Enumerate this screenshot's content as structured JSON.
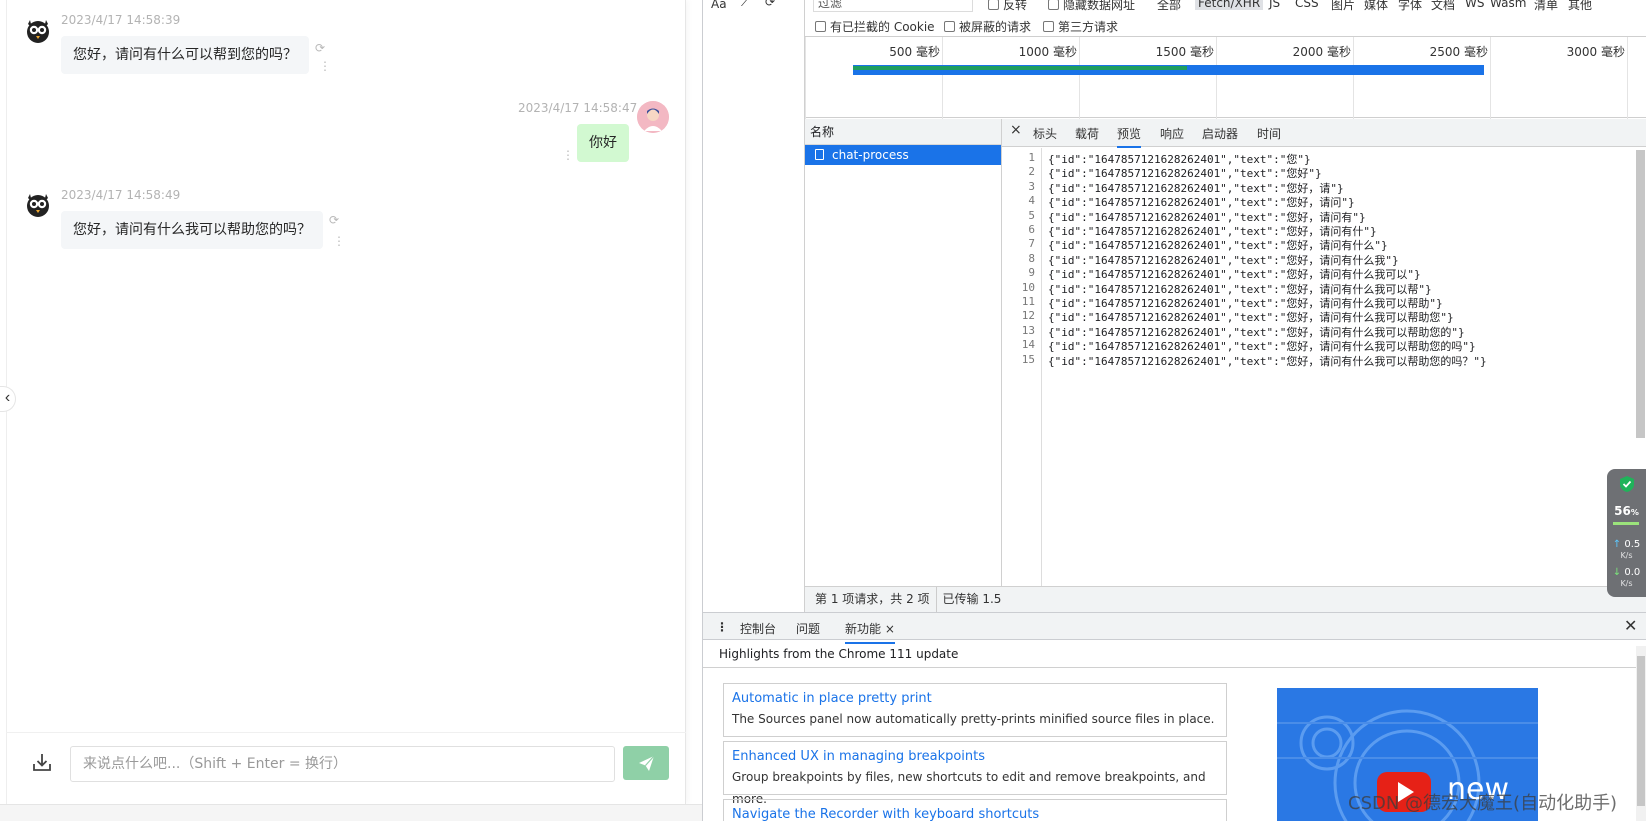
{
  "chat": {
    "messages": [
      {
        "role": "assistant",
        "time": "2023/4/17 14:58:39",
        "text": "您好，请问有什么可以帮到您的吗？"
      },
      {
        "role": "user",
        "time": "2023/4/17 14:58:47",
        "text": "你好"
      },
      {
        "role": "assistant",
        "time": "2023/4/17 14:58:49",
        "text": "您好，请问有什么我可以帮助您的吗？"
      }
    ],
    "input_placeholder": "来说点什么吧...（Shift + Enter = 换行）",
    "colors": {
      "send_button": "#8fd0a7",
      "user_bubble": "#d2f9d1",
      "bot_bubble": "#f4f6f8"
    }
  },
  "devtools": {
    "toolbar": {
      "font_label": "Aa",
      "filter_placeholder": "过滤"
    },
    "filter_chips": [
      "反转",
      "隐藏数据网址",
      "全部",
      "Fetch/XHR",
      "JS",
      "CSS",
      "图片",
      "媒体",
      "字体",
      "文档",
      "WS",
      "Wasm",
      "清单",
      "其他"
    ],
    "checkboxes": [
      "有已拦截的 Cookie",
      "被屏蔽的请求",
      "第三方请求"
    ],
    "timeline_ticks": [
      "500 毫秒",
      "1000 毫秒",
      "1500 毫秒",
      "2000 毫秒",
      "2500 毫秒",
      "3000 毫秒"
    ],
    "request_list": {
      "header": "名称",
      "items": [
        "chat-process"
      ],
      "footer_requests": "第 1 项请求，共 2 项",
      "footer_transferred": "已传输 1.5"
    },
    "detail_tabs": [
      "标头",
      "载荷",
      "预览",
      "响应",
      "启动器",
      "时间"
    ],
    "detail_active_tab": "预览",
    "preview_lines": [
      "{\"id\":\"1647857121628262401\",\"text\":\"您\"}",
      "{\"id\":\"1647857121628262401\",\"text\":\"您好\"}",
      "{\"id\":\"1647857121628262401\",\"text\":\"您好，请\"}",
      "{\"id\":\"1647857121628262401\",\"text\":\"您好，请问\"}",
      "{\"id\":\"1647857121628262401\",\"text\":\"您好，请问有\"}",
      "{\"id\":\"1647857121628262401\",\"text\":\"您好，请问有什\"}",
      "{\"id\":\"1647857121628262401\",\"text\":\"您好，请问有什么\"}",
      "{\"id\":\"1647857121628262401\",\"text\":\"您好，请问有什么我\"}",
      "{\"id\":\"1647857121628262401\",\"text\":\"您好，请问有什么我可以\"}",
      "{\"id\":\"1647857121628262401\",\"text\":\"您好，请问有什么我可以帮\"}",
      "{\"id\":\"1647857121628262401\",\"text\":\"您好，请问有什么我可以帮助\"}",
      "{\"id\":\"1647857121628262401\",\"text\":\"您好，请问有什么我可以帮助您\"}",
      "{\"id\":\"1647857121628262401\",\"text\":\"您好，请问有什么我可以帮助您的\"}",
      "{\"id\":\"1647857121628262401\",\"text\":\"您好，请问有什么我可以帮助您的吗\"}",
      "{\"id\":\"1647857121628262401\",\"text\":\"您好，请问有什么我可以帮助您的吗？\"}"
    ],
    "drawer": {
      "tabs": [
        "控制台",
        "问题",
        "新功能"
      ],
      "active_tab": "新功能",
      "subtitle": "Highlights from the Chrome 111 update",
      "features": [
        {
          "title": "Automatic in place pretty print",
          "desc": "The Sources panel now automatically pretty-prints minified source files in place."
        },
        {
          "title": "Enhanced UX in managing breakpoints",
          "desc": "Group breakpoints by files, new shortcuts to edit and remove breakpoints, and more."
        },
        {
          "title": "Navigate the Recorder with keyboard shortcuts",
          "desc": ""
        }
      ],
      "promo_text": "new"
    },
    "accent_color": "#1a73e8"
  },
  "speed_widget": {
    "percent": "56",
    "percent_unit": "%",
    "upload": "0.5",
    "download": "0.0",
    "unit": "K/s"
  },
  "watermark": "CSDN @德宏大魔王(自动化助手)"
}
